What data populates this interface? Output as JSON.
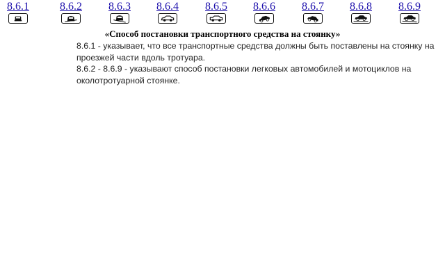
{
  "signs": [
    {
      "label": "8.6.1",
      "icon": "car-on-roadway-sign-icon"
    },
    {
      "label": "8.6.2",
      "icon": "car-on-sidewalk-edge-sign-icon"
    },
    {
      "label": "8.6.3",
      "icon": "car-half-on-sidewalk-sign-icon"
    },
    {
      "label": "8.6.4",
      "icon": "car-side-parallel-sign-icon"
    },
    {
      "label": "8.6.5",
      "icon": "car-side-parallel-sign-icon"
    },
    {
      "label": "8.6.6",
      "icon": "car-angled-parking-sign-icon"
    },
    {
      "label": "8.6.7",
      "icon": "car-angled-parking-sign-icon"
    },
    {
      "label": "8.6.8",
      "icon": "car-side-on-sidewalk-sign-icon"
    },
    {
      "label": "8.6.9",
      "icon": "car-side-on-sidewalk-sign-icon"
    }
  ],
  "caption": "«Способ постановки транспортного средства на стоянку»",
  "description": {
    "line1": "8.6.1 - указывает, что все транспортные средства должны быть поставлены на стоянку на проезжей части вдоль тротуара.",
    "line2": "8.6.2 - 8.6.9 - указывают способ постановки легковых автомобилей и мотоциклов на околотротуарной стоянке."
  },
  "colors": {
    "link": "#1a0dab",
    "text": "#222222",
    "plate_border": "#111111"
  }
}
